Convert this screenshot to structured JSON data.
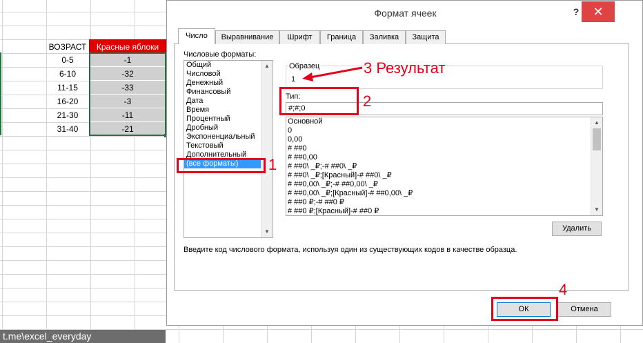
{
  "sheet": {
    "header_age": "ВОЗРАСТ",
    "header_red": "Красные яблоки",
    "rows": [
      {
        "age": "0-5",
        "value": "-1"
      },
      {
        "age": "6-10",
        "value": "-32"
      },
      {
        "age": "11-15",
        "value": "-33"
      },
      {
        "age": "16-20",
        "value": "-3"
      },
      {
        "age": "21-30",
        "value": "-11"
      },
      {
        "age": "31-40",
        "value": "-21"
      }
    ],
    "footer_text": "t.me\\excel_everyday"
  },
  "dialog": {
    "title": "Формат ячеек",
    "help": "?",
    "close": "✕",
    "tabs": [
      "Число",
      "Выравнивание",
      "Шрифт",
      "Граница",
      "Заливка",
      "Защита"
    ],
    "formats_label": "Числовые форматы:",
    "formats": [
      "Общий",
      "Числовой",
      "Денежный",
      "Финансовый",
      "Дата",
      "Время",
      "Процентный",
      "Дробный",
      "Экспоненциальный",
      "Текстовый",
      "Дополнительный",
      "(все форматы)"
    ],
    "sample_label": "Образец",
    "sample_value": "1",
    "type_label": "Тип:",
    "type_value": "#;#;0",
    "format_codes": [
      "Основной",
      "0",
      "0,00",
      "# ##0",
      "# ##0,00",
      "# ##0\\ _₽;-# ##0\\ _₽",
      "# ##0\\ _₽;[Красный]-# ##0\\ _₽",
      "# ##0,00\\ _₽;-# ##0,00\\ _₽",
      "# ##0,00\\ _₽;[Красный]-# ##0,00\\ _₽",
      "# ##0 ₽;-# ##0 ₽",
      "# ##0 ₽;[Красный]-# ##0 ₽"
    ],
    "delete_button": "Удалить",
    "description": "Введите код числового формата, используя один из существующих кодов в качестве образца.",
    "ok_button": "ОК",
    "cancel_button": "Отмена"
  },
  "annotations": {
    "num1": "1",
    "num2": "2",
    "result_text": "3 Результат",
    "num4": "4"
  }
}
